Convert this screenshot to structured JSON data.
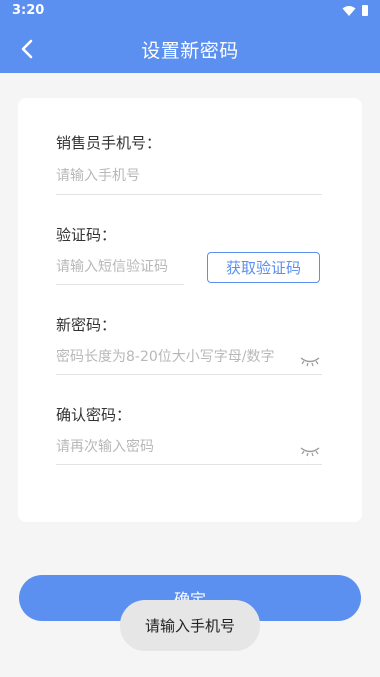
{
  "status_bar": {
    "time": "3:20",
    "icons": [
      "wifi-icon",
      "battery-icon"
    ]
  },
  "header": {
    "title": "设置新密码",
    "back_icon": "back-arrow-icon"
  },
  "form": {
    "phone": {
      "label": "销售员手机号：",
      "placeholder": "请输入手机号",
      "value": ""
    },
    "code": {
      "label": "验证码：",
      "placeholder": "请输入短信验证码",
      "value": "",
      "button_label": "获取验证码"
    },
    "new_password": {
      "label": "新密码：",
      "placeholder": "密码长度为8-20位大小写字母/数字",
      "value": "",
      "toggle_icon": "eye-closed-icon"
    },
    "confirm_password": {
      "label": "确认密码：",
      "placeholder": "请再次输入密码",
      "value": "",
      "toggle_icon": "eye-closed-icon"
    }
  },
  "confirm_button_label": "确定",
  "toast": "请输入手机号",
  "colors": {
    "primary": "#5b8ff0",
    "background": "#f5f5f5",
    "placeholder": "#b8b8b8"
  }
}
